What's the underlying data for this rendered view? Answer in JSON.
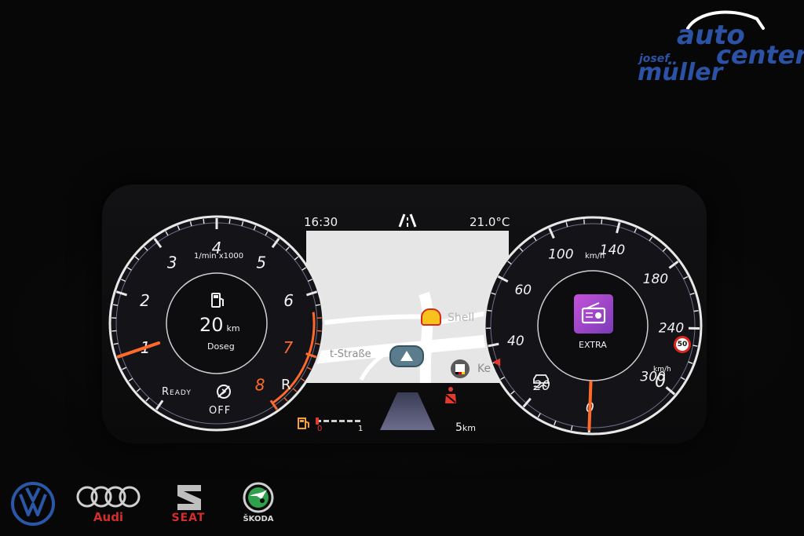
{
  "dealer": {
    "line1": "auto",
    "line2": "center",
    "first_name": "josef",
    "last_name": "müller",
    "color": "#2b52a5"
  },
  "status_bar": {
    "time": "16:30",
    "temperature": "21.0°C",
    "lane_icon": "lane-assist-icon"
  },
  "tachometer": {
    "unit_label": "1/min x1000",
    "ticks": [
      "1",
      "2",
      "3",
      "4",
      "5",
      "6",
      "7",
      "8"
    ],
    "redline_ticks": [
      "7",
      "8"
    ],
    "needle_value": 1,
    "max_value": 8,
    "range_value": "20",
    "range_unit": "km",
    "range_label": "Doseg",
    "ready_label": "Ready",
    "mode_label": "OFF",
    "gear": "R",
    "accent": "#ff6a2a"
  },
  "navigation": {
    "poi_label": "Shell",
    "street_label": "t-Straße",
    "poi2_label": "Ke",
    "distance_value": "5",
    "distance_unit": "km"
  },
  "battery_bar": {
    "min_label": "0",
    "max_label": "1"
  },
  "speedometer": {
    "unit_label": "km/h",
    "bottom_unit_label": "km/h",
    "ticks": [
      "0",
      "20",
      "40",
      "60",
      "100",
      "140",
      "180",
      "240",
      "300"
    ],
    "bottom_right_value": "0",
    "needle_value": 0,
    "speed_limit": "50",
    "media_label": "EXTRA",
    "media_color": "#a543c8"
  },
  "brands": {
    "vw": "VW",
    "audi": "Audi",
    "seat": "SEAT",
    "skoda": "ŠKODA"
  }
}
